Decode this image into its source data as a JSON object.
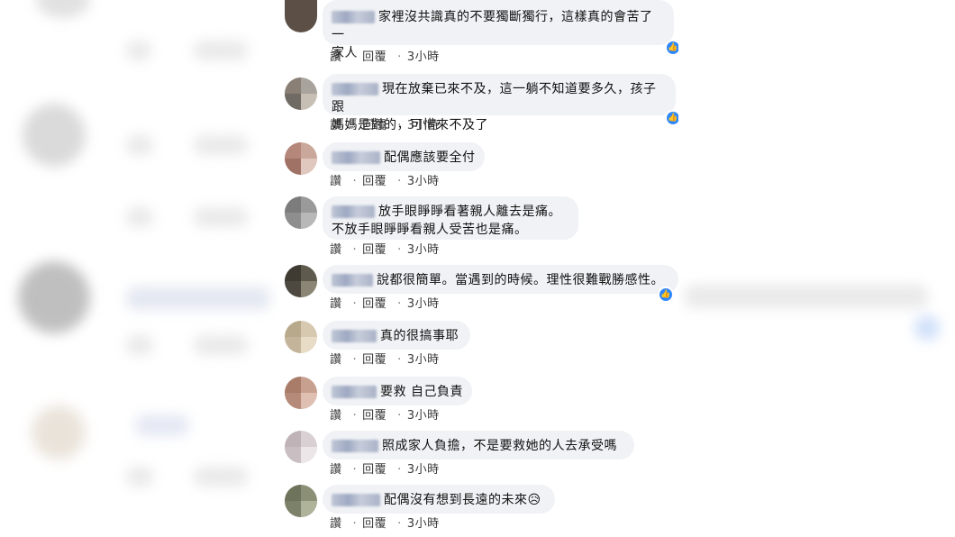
{
  "actions": {
    "like": "讚",
    "reply": "回覆",
    "separator": "·"
  },
  "comments": [
    {
      "text": "家裡沒共識真的不要獨斷獨行，這樣真的會苦了一\n家人",
      "time": "3小時",
      "has_reaction": true
    },
    {
      "text": "現在放棄已來不及，這一躺不知道要多久，孩子跟\n媽媽是對的，可惜來不及了",
      "time": "3小時",
      "has_reaction": true
    },
    {
      "text": "配偶應該要全付",
      "time": "3小時",
      "has_reaction": false
    },
    {
      "text": "放手眼睜睜看著親人離去是痛。\n不放手眼睜睜看親人受苦也是痛。",
      "time": "3小時",
      "has_reaction": false
    },
    {
      "text": "說都很簡單。當遇到的時候。理性很難戰勝感性。",
      "time": "3小時",
      "has_reaction": true
    },
    {
      "text": "真的很搞事耶",
      "time": "3小時",
      "has_reaction": false
    },
    {
      "text": "要救 自己負責",
      "time": "3小時",
      "has_reaction": false
    },
    {
      "text": "照成家人負擔，不是要救她的人去承受嗎",
      "time": "3小時",
      "has_reaction": false
    },
    {
      "text": "配偶沒有想到長遠的未來😥",
      "time": "3小時",
      "has_reaction": false
    }
  ],
  "colors": {
    "bubble": "#f0f2f5",
    "reaction": "#2d88ff",
    "action_text": "#3a3a3a"
  },
  "icons": {
    "reaction": "like-reaction-icon"
  }
}
